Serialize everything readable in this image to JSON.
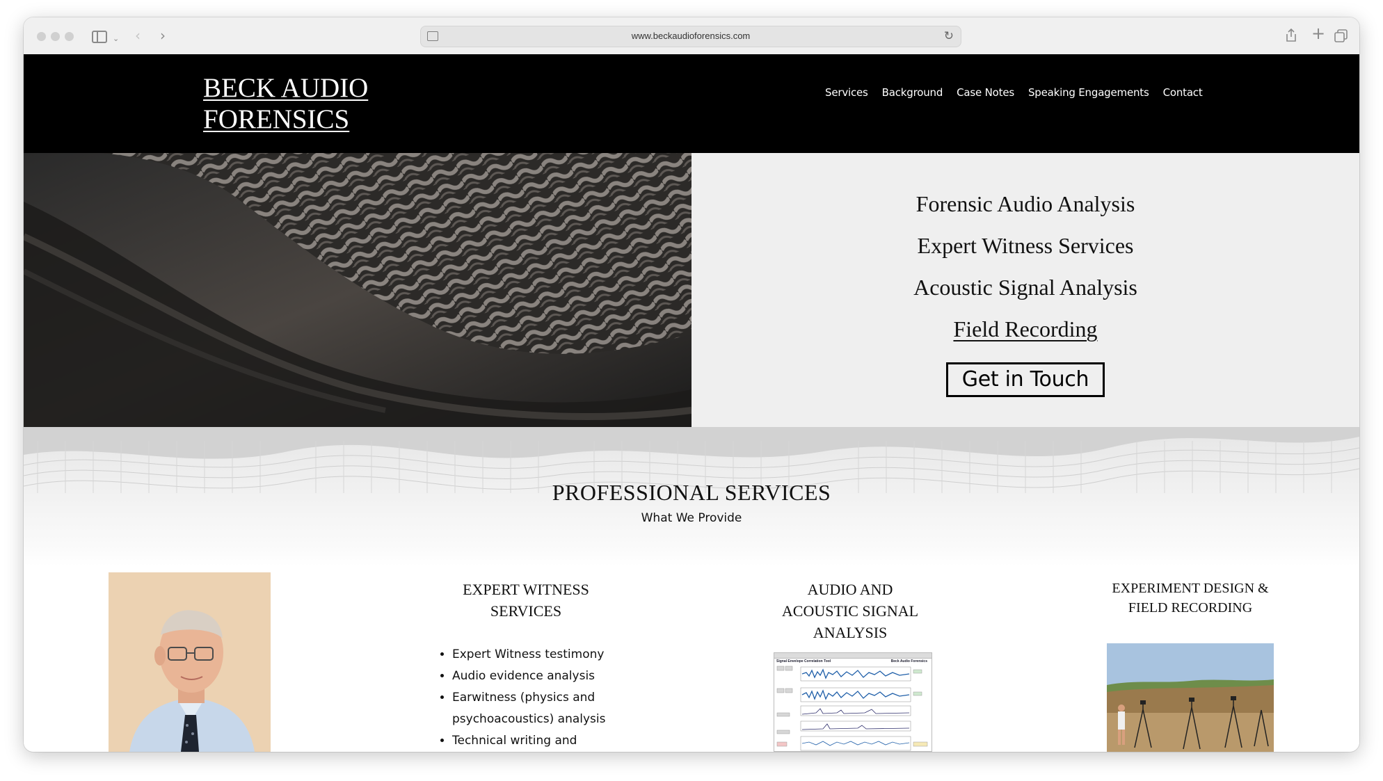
{
  "browser": {
    "url": "www.beckaudioforensics.com"
  },
  "site": {
    "logo_line1": "BECK AUDIO",
    "logo_line2": "FORENSICS",
    "nav": [
      "Services",
      "Background",
      "Case Notes",
      "Speaking Engagements",
      "Contact"
    ]
  },
  "hero": {
    "lines": [
      "Forensic Audio Analysis",
      "Expert Witness Services",
      "Acoustic Signal Analysis"
    ],
    "link_line": "Field Recording",
    "cta_label": "Get in Touch"
  },
  "services": {
    "title": "PROFESSIONAL SERVICES",
    "subtitle": "What We Provide",
    "columns": [
      {
        "title_lines": [
          "EXPERT WITNESS",
          "SERVICES"
        ],
        "bullets": [
          "Expert Witness testimony",
          "Audio evidence analysis",
          "Earwitness (physics and psychoacoustics) analysis",
          "Technical writing and"
        ]
      },
      {
        "title_lines": [
          "AUDIO AND",
          "ACOUSTIC SIGNAL",
          "ANALYSIS"
        ],
        "thumb_title": "Signal Envelope Correlation Tool",
        "thumb_brand": "Beck Audio Forensics"
      },
      {
        "title_lines": [
          "EXPERIMENT DESIGN &",
          "FIELD RECORDING"
        ]
      }
    ]
  },
  "colors": {
    "header_bg": "#000000",
    "hero_panel_bg": "#efefef",
    "chrome_bg": "#f0f0f0"
  }
}
